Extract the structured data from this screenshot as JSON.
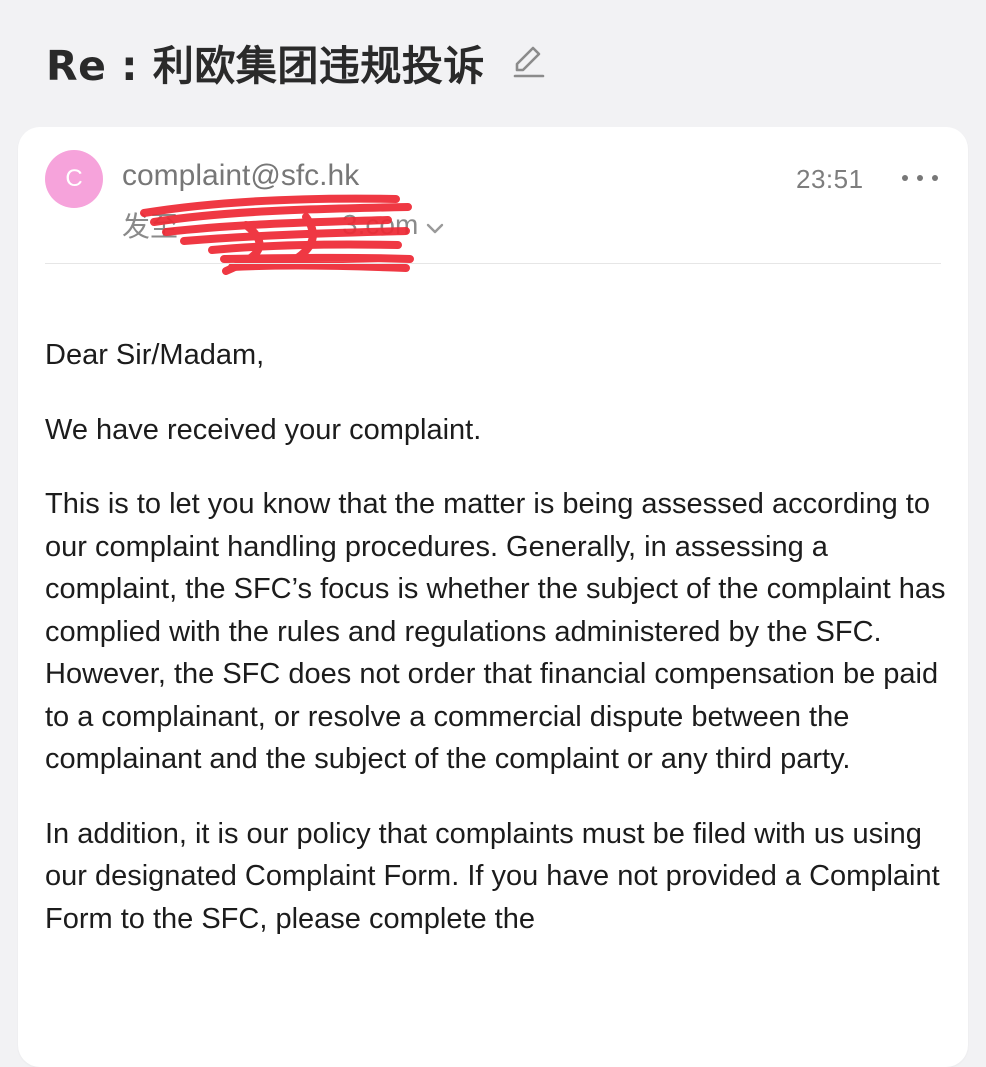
{
  "subject": {
    "title": "Re : 利欧集团违规投诉",
    "edit_icon": "pencil-edit-icon"
  },
  "message": {
    "avatar_initial": "C",
    "avatar_color": "#f6a3db",
    "sender_email": "complaint@sfc.hk",
    "time": "23:51",
    "more_icon": "more-horizontal-icon",
    "recipient_prefix": "发至 ",
    "recipient_visible": "3.com",
    "recipient_scribble_color": "#ee2a35",
    "expand_icon": "chevron-down-icon"
  },
  "body": {
    "paragraphs": [
      "Dear Sir/Madam,",
      "We have received your complaint.",
      "This is to let you know that the matter is being assessed according to our complaint handling procedures. Generally, in assessing a complaint, the SFC’s focus is whether the subject of the complaint has complied with the rules and regulations administered by the SFC. However, the SFC does not order that financial compensation be paid to a complainant, or resolve a commercial dispute between the complainant and the subject of the complaint or any third party.",
      "In addition, it is our policy that complaints must be filed with us using our designated Complaint Form. If you have not provided a Complaint Form to the SFC, please complete the"
    ]
  }
}
